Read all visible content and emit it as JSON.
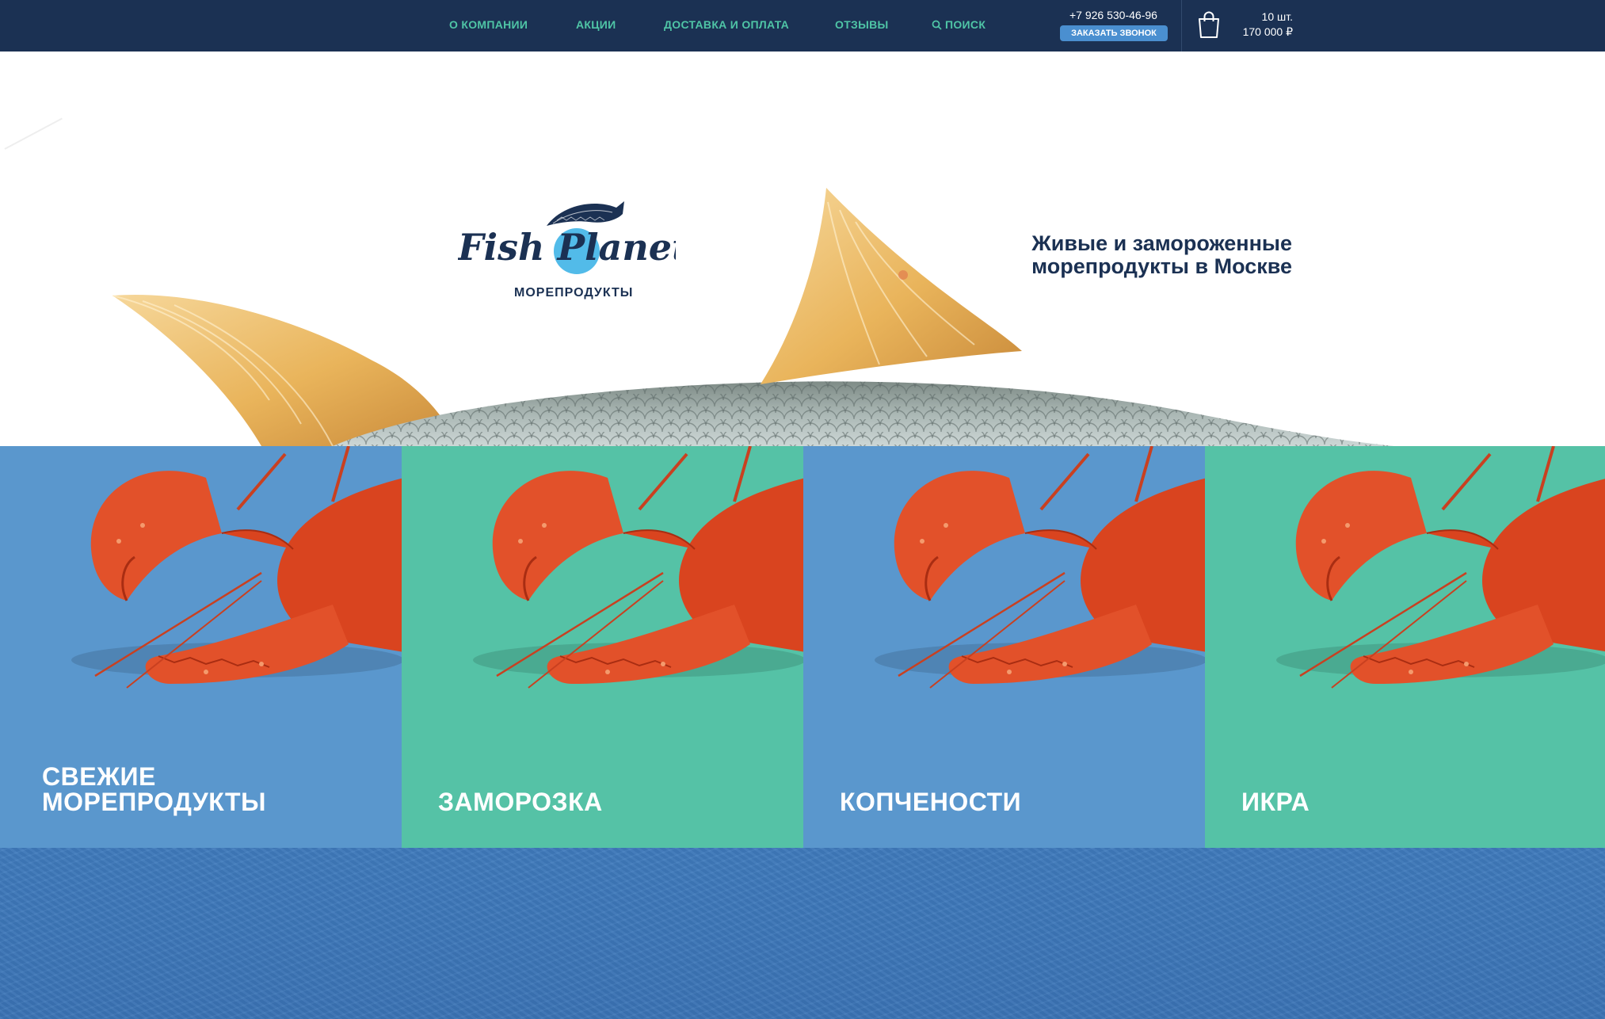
{
  "nav": {
    "items": [
      {
        "label": "О КОМПАНИИ"
      },
      {
        "label": "АКЦИИ"
      },
      {
        "label": "ДОСТАВКА И ОПЛАТА"
      },
      {
        "label": "ОТЗЫВЫ"
      },
      {
        "label": "ПОИСК",
        "icon": "search-icon"
      }
    ]
  },
  "contact": {
    "phone": "+7 926 530-46-96",
    "callback_label": "ЗАКАЗАТЬ ЗВОНОК",
    "messengers": [
      "telegram-icon",
      "whatsapp-icon",
      "viber-icon"
    ]
  },
  "cart": {
    "icon": "shopping-bag-icon",
    "quantity": "10 шт.",
    "total": "170 000 ₽"
  },
  "hero": {
    "logo_text": "Fish Planet",
    "logo_subtitle": "МОРЕПРОДУКТЫ",
    "tagline_line1": "Живые и замороженные",
    "tagline_line2": "морепродукты в Москве"
  },
  "categories": [
    {
      "line1": "СВЕЖИЕ",
      "line2": "МОРЕПРОДУКТЫ"
    },
    {
      "line1": "",
      "line2": "ЗАМОРОЗКА"
    },
    {
      "line1": "",
      "line2": "КОПЧЕНОСТИ"
    },
    {
      "line1": "",
      "line2": "ИКРА"
    }
  ],
  "colors": {
    "header_bg": "#1b3153",
    "nav_text": "#4fc5a6",
    "callback_btn": "#4a8fd0",
    "messenger_bg": "#55c2a6",
    "tile_blue": "#5a97cd",
    "tile_green": "#55c2a6",
    "bottom_band": "#3f7bbd"
  }
}
